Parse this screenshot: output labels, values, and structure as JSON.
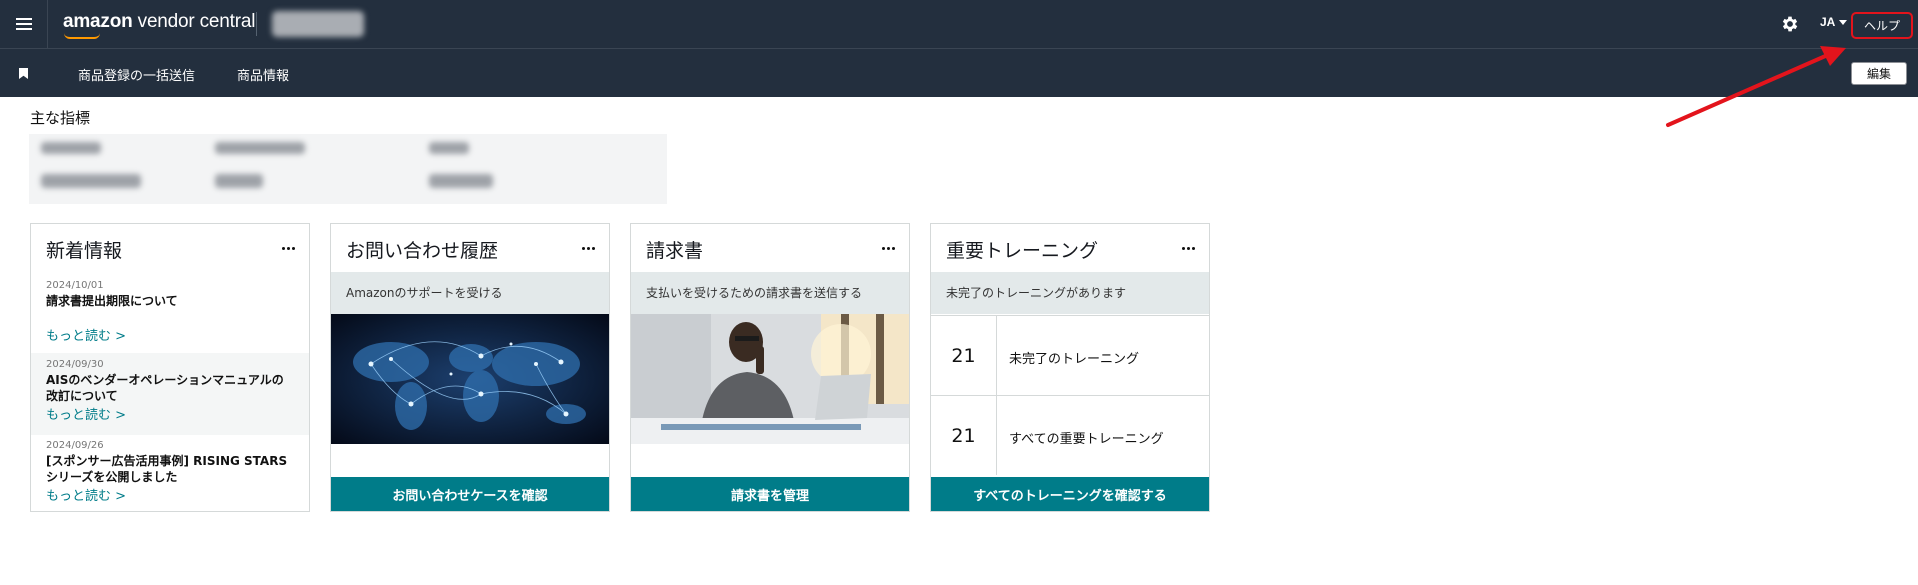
{
  "topbar": {
    "logo_brand": "amazon",
    "logo_product": "vendor central",
    "language": "JA",
    "help_label": "ヘルプ"
  },
  "subnav": {
    "links": [
      "商品登録の一括送信",
      "商品情報"
    ],
    "edit_label": "編集"
  },
  "metrics": {
    "title": "主な指標"
  },
  "cards": {
    "news": {
      "title": "新着情報",
      "items": [
        {
          "date": "2024/10/01",
          "text": "請求書提出期限について",
          "more": "もっと読む >"
        },
        {
          "date": "2024/09/30",
          "text": "AISのベンダーオペレーションマニュアルの改訂について",
          "more": "もっと読む >"
        },
        {
          "date": "2024/09/26",
          "text": "[スポンサー広告活用事例] RISING STARS シリーズを公開しました",
          "more": "もっと読む >"
        }
      ]
    },
    "inquiry": {
      "title": "お問い合わせ履歴",
      "subtitle": "Amazonのサポートを受ける",
      "action": "お問い合わせケースを確認"
    },
    "invoice": {
      "title": "請求書",
      "subtitle": "支払いを受けるための請求書を送信する",
      "action": "請求書を管理"
    },
    "training": {
      "title": "重要トレーニング",
      "subtitle": "未完了のトレーニングがあります",
      "rows": [
        {
          "count": "21",
          "label": "未完了のトレーニング"
        },
        {
          "count": "21",
          "label": "すべての重要トレーニング"
        }
      ],
      "action": "すべてのトレーニングを確認する"
    }
  },
  "colors": {
    "header_bg": "#232f3e",
    "accent_teal": "#007c89",
    "highlight_red": "#e3141c",
    "logo_orange": "#ff9900"
  }
}
